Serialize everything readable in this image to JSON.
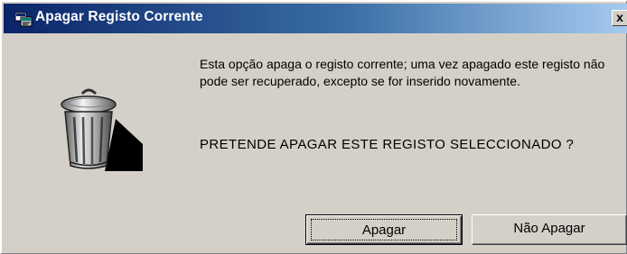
{
  "window": {
    "title": "Apagar Registo Corrente",
    "close_label": "x",
    "app_icon": "database-app-icon"
  },
  "dialog": {
    "icon": "trash-can-icon",
    "message": "Esta opção apaga o registo corrente; uma vez apagado este registo não pode ser recuperado, excepto se for inserido novamente.",
    "question": "PRETENDE APAGAR ESTE REGISTO SELECCIONADO ?"
  },
  "buttons": {
    "confirm_label": "Apagar",
    "cancel_label": "Não Apagar"
  },
  "colors": {
    "title_bar_start": "#0a246a",
    "title_bar_end": "#a6caf0",
    "dialog_face": "#d4d0c8"
  }
}
